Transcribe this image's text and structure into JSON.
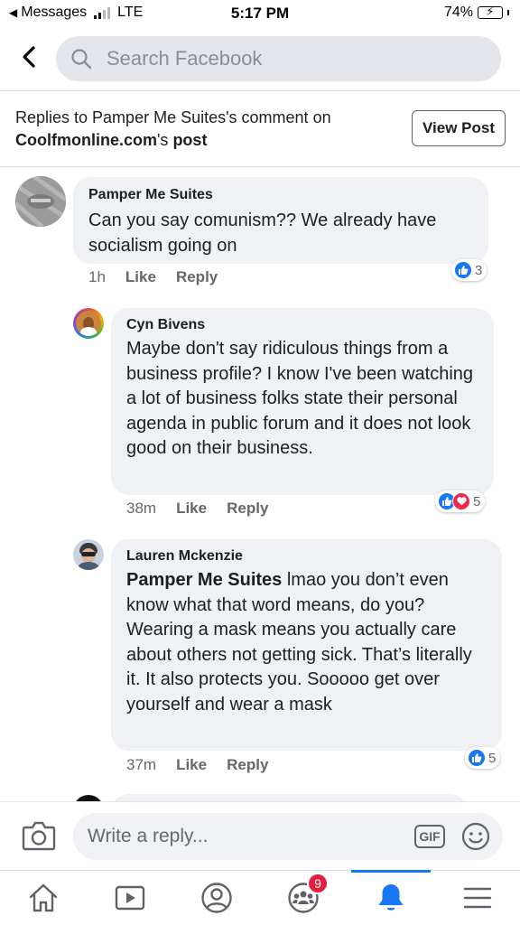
{
  "status_bar": {
    "back_app": "Messages",
    "carrier": "LTE",
    "time": "5:17 PM",
    "battery_percent": "74%",
    "battery_level": 0.74
  },
  "search": {
    "placeholder": "Search Facebook"
  },
  "context": {
    "prefix": "Replies to Pamper Me Suites's comment on",
    "page_name": "Coolfmonline.com",
    "possessive": "'s ",
    "post_word": "post",
    "view_post_label": "View Post"
  },
  "comments": [
    {
      "author": "Pamper Me Suites",
      "text": "Can you say comunism?? We already have socialism going on",
      "time": "1h",
      "like_label": "Like",
      "reply_label": "Reply",
      "reaction_count": "3",
      "reactions": [
        "like"
      ]
    },
    {
      "author": "Cyn Bivens",
      "text": "Maybe don't say ridiculous things from a business profile? I know I've been watching a lot of business folks state their personal agenda in public forum and it does not look good on their business.",
      "time": "38m",
      "like_label": "Like",
      "reply_label": "Reply",
      "reaction_count": "5",
      "reactions": [
        "like",
        "love"
      ]
    },
    {
      "author": "Lauren Mckenzie",
      "mention": "Pamper Me Suites",
      "text": " lmao you don’t even know what that word means, do you? Wearing a mask means you actually care about others not getting sick. That’s literally it. It also protects you. Sooooo get over yourself and wear a mask",
      "time": "37m",
      "like_label": "Like",
      "reply_label": "Reply",
      "reaction_count": "5",
      "reactions": [
        "like"
      ]
    }
  ],
  "composer": {
    "placeholder": "Write a reply...",
    "gif_label": "GIF"
  },
  "tabbar": {
    "items": [
      "home-icon",
      "watch-icon",
      "profile-icon",
      "groups-icon",
      "notifications-icon",
      "menu-icon"
    ],
    "groups_badge": "9",
    "active": "notifications-icon"
  },
  "colors": {
    "accent": "#1877f2",
    "love": "#f0284a",
    "badge": "#e41e3f",
    "bubble": "#eff1f4"
  }
}
